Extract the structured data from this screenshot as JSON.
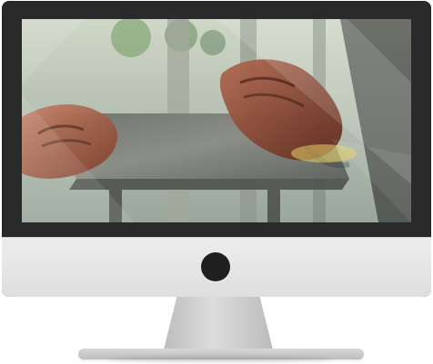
{
  "device": {
    "type": "desktop-monitor",
    "screen_image": "photo-shoe-on-wooden-bench",
    "stand": "metal-stand",
    "home_button_icon": "home-button-icon"
  },
  "colors": {
    "frame": "#2a2a2a",
    "chin": "#e8e8e8",
    "stand": "#c8c8c8",
    "screen_bg": "#7b8478"
  }
}
